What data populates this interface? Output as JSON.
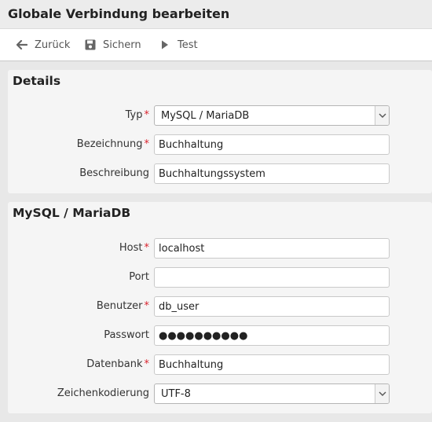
{
  "window": {
    "title": "Globale Verbindung bearbeiten"
  },
  "toolbar": {
    "back_label": "Zurück",
    "save_label": "Sichern",
    "test_label": "Test"
  },
  "details": {
    "title": "Details",
    "type": {
      "label": "Typ",
      "required": true,
      "value": "MySQL / MariaDB"
    },
    "name": {
      "label": "Bezeichnung",
      "required": true,
      "value": "Buchhaltung"
    },
    "description": {
      "label": "Beschreibung",
      "required": false,
      "value": "Buchhaltungssystem"
    }
  },
  "mysql": {
    "title": "MySQL / MariaDB",
    "host": {
      "label": "Host",
      "required": true,
      "value": "localhost"
    },
    "port": {
      "label": "Port",
      "required": false,
      "value": ""
    },
    "user": {
      "label": "Benutzer",
      "required": true,
      "value": "db_user"
    },
    "password": {
      "label": "Passwort",
      "required": false,
      "value": "●●●●●●●●●●"
    },
    "database": {
      "label": "Datenbank",
      "required": true,
      "value": "Buchhaltung"
    },
    "encoding": {
      "label": "Zeichenkodierung",
      "required": false,
      "value": "UTF-8"
    }
  },
  "colors": {
    "required_marker": "#d9232e",
    "panel_bg": "#f5f5f5",
    "toolbar_bg": "#ffffff"
  },
  "icons": {
    "back": "arrow-left-icon",
    "save": "floppy-disk-icon",
    "test": "play-icon",
    "select": "chevron-down-icon"
  }
}
